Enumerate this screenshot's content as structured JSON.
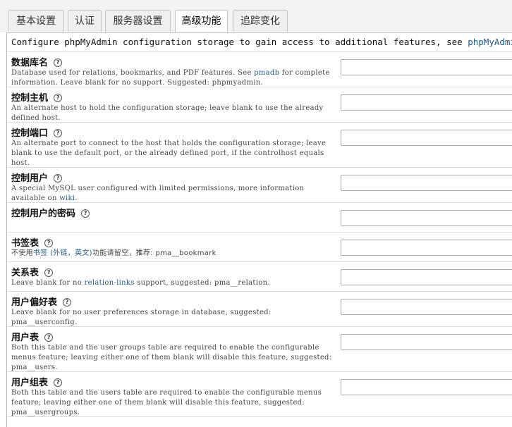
{
  "tabs": [
    {
      "label": "基本设置",
      "active": false
    },
    {
      "label": "认证",
      "active": false
    },
    {
      "label": "服务器设置",
      "active": false
    },
    {
      "label": "高级功能",
      "active": true
    },
    {
      "label": "追踪变化",
      "active": false
    }
  ],
  "intro": {
    "text": "Configure phpMyAdmin configuration storage to gain access to additional features, see ",
    "link": "phpMyAdmin configuration storage"
  },
  "settings": [
    {
      "label": "数据库名",
      "desc_before": "Database used for relations, bookmarks, and PDF features. See ",
      "desc_link": "pmadb",
      "desc_after": " for complete information. Leave blank for no support. Suggested: phpmyadmin.",
      "value": ""
    },
    {
      "label": "控制主机",
      "desc_before": "An alternate host to hold the configuration storage; leave blank to use the already defined host.",
      "value": ""
    },
    {
      "label": "控制端口",
      "desc_before": "An alternate port to connect to the host that holds the configuration storage; leave blank to use the default port, or the already defined port, if the controlhost equals host.",
      "value": ""
    },
    {
      "label": "控制用户",
      "desc_before": "A special MySQL user configured with limited permissions, more information available on ",
      "desc_link": "wiki",
      "desc_after": ".",
      "value": ""
    },
    {
      "label": "控制用户的密码",
      "value": ""
    },
    {
      "label": "书签表",
      "desc_before": "不使用",
      "desc_link": "书签 (外链，英文)",
      "desc_after": "功能请留空，推荐: pma__bookmark",
      "value": ""
    },
    {
      "label": "关系表",
      "desc_before": "Leave blank for no ",
      "desc_link": "relation-links",
      "desc_after": " support, suggested: pma__relation.",
      "value": ""
    },
    {
      "label": "用户偏好表",
      "desc_before": "Leave blank for no user preferences storage in database, suggested: pma__userconfig.",
      "value": ""
    },
    {
      "label": "用户表",
      "desc_before": "Both this table and the user groups table are required to enable the configurable menus feature; leaving either one of them blank will disable this feature, suggested: pma__users.",
      "value": ""
    },
    {
      "label": "用户组表",
      "desc_before": "Both this table and the users table are required to enable the configurable menus feature; leaving either one of them blank will disable this feature, suggested: pma__usergroups.",
      "value": ""
    }
  ],
  "help_icon": "help-icon"
}
